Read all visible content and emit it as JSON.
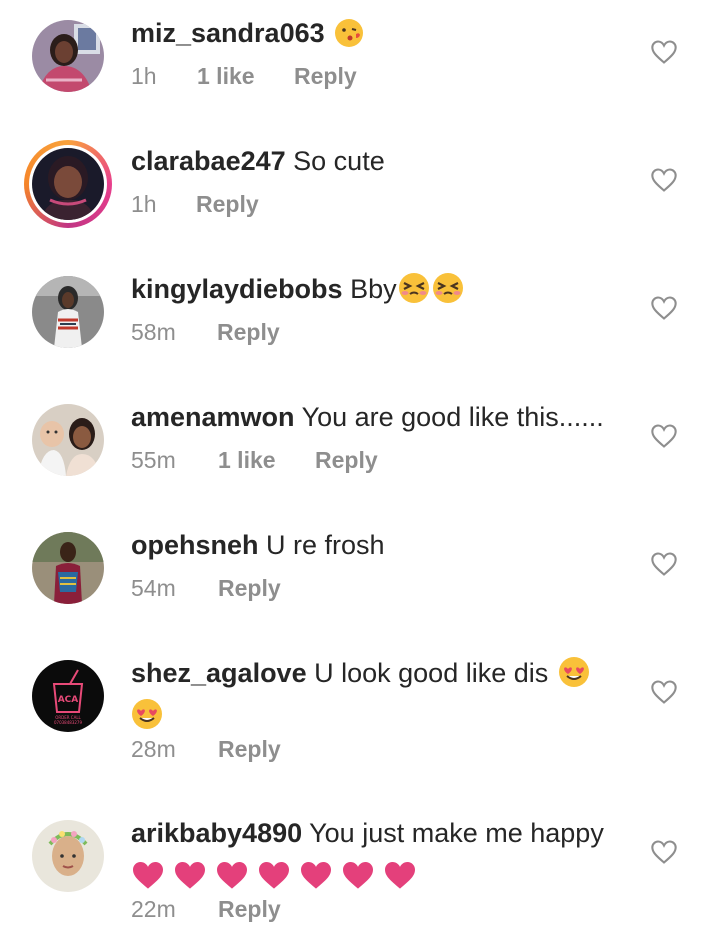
{
  "comments": [
    {
      "username": "miz_sandra063",
      "text": "",
      "time": "1h",
      "likes": "1 like",
      "reply": "Reply",
      "emoji": [
        "kissing-face-emoji"
      ]
    },
    {
      "username": "clarabae247",
      "text": "So cute",
      "time": "1h",
      "likes": "",
      "reply": "Reply",
      "has_story": true
    },
    {
      "username": "kingylaydiebobs",
      "text": "Bby",
      "time": "58m",
      "likes": "",
      "reply": "Reply",
      "emoji": [
        "squinting-face-emoji",
        "squinting-face-emoji"
      ]
    },
    {
      "username": "amenamwon",
      "text": "You are good like this......",
      "time": "55m",
      "likes": "1 like",
      "reply": "Reply"
    },
    {
      "username": "opehsneh",
      "text": "U re frosh",
      "time": "54m",
      "likes": "",
      "reply": "Reply"
    },
    {
      "username": "shez_agalove",
      "text": "U look good like dis",
      "time": "28m",
      "likes": "",
      "reply": "Reply",
      "emoji": [
        "heart-eyes-emoji",
        "heart-eyes-emoji"
      ]
    },
    {
      "username": "arikbaby4890",
      "text": "You just make me happy",
      "time": "22m",
      "likes": "",
      "reply": "Reply",
      "emoji": [
        "pink-heart-emoji",
        "pink-heart-emoji",
        "pink-heart-emoji",
        "pink-heart-emoji",
        "pink-heart-emoji",
        "pink-heart-emoji",
        "pink-heart-emoji"
      ]
    }
  ],
  "colors": {
    "text": "#262626",
    "meta": "#8e8e8e",
    "heart_outline": "#8e8e8e",
    "pink_heart": "#e4407b"
  },
  "avatar_badge": {
    "line1": "ORDER CALL",
    "line2": "07038483279"
  }
}
